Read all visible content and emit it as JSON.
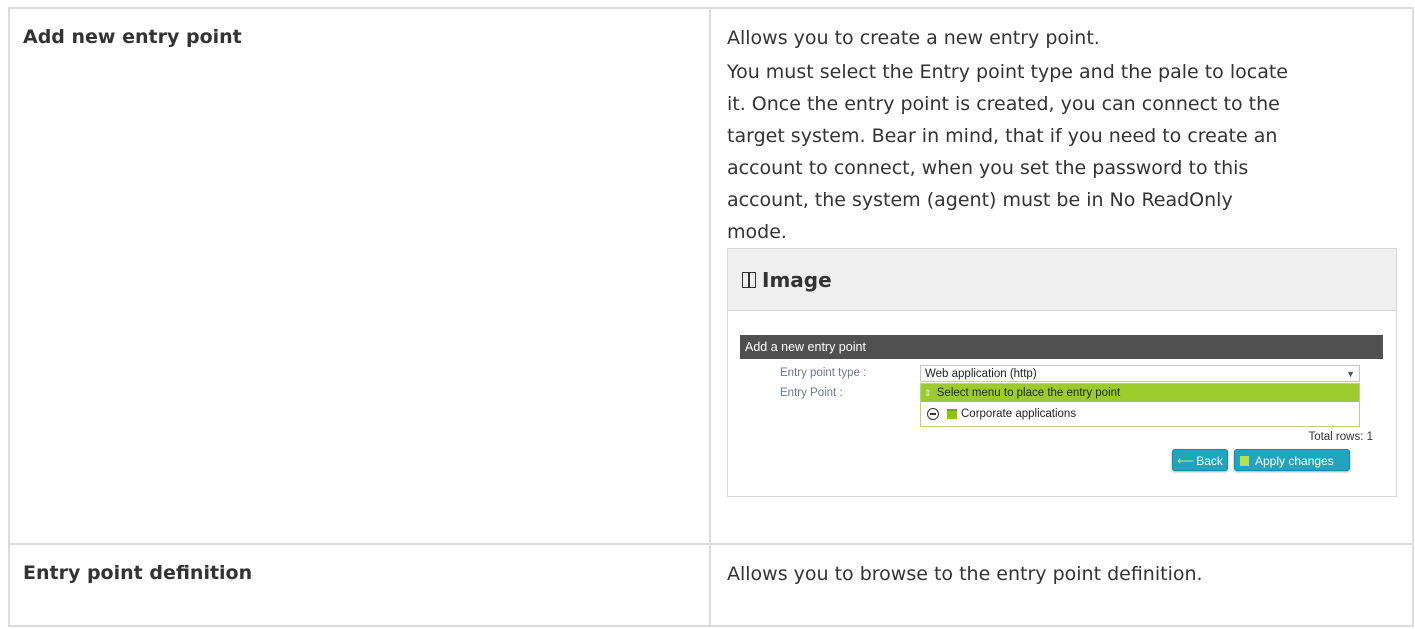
{
  "rows": [
    {
      "term": "Add new entry point",
      "description_lines": [
        "Allows you to create a new entry point.",
        "You must select the Entry point type and the pale to locate",
        "it. Once the entry point is created, you can connect to the",
        "target system. Bear in mind, that if you need to create an",
        "account to connect, when you set the password to this",
        "account, the system (agent) must be in No ReadOnly",
        "mode."
      ],
      "image_panel": {
        "title": "Image",
        "icon": "book-icon",
        "screenshot": {
          "title": "Add a new entry point",
          "entry_point_type_label": "Entry point type :",
          "entry_point_type_value": "Web application (http)",
          "entry_point_label": "Entry Point :",
          "tree_header": "Select menu to place the entry point",
          "tree_item": "Corporate applications",
          "total_rows": "Total rows: 1",
          "back_label": "Back",
          "apply_label": "Apply changes",
          "colors": {
            "title_bar": "#505050",
            "tree_header": "#9ccb2e",
            "button": "#20a4bf"
          }
        }
      }
    },
    {
      "term": "Entry point definition",
      "description_lines": [
        "Allows you to browse to the entry point definition."
      ]
    }
  ]
}
